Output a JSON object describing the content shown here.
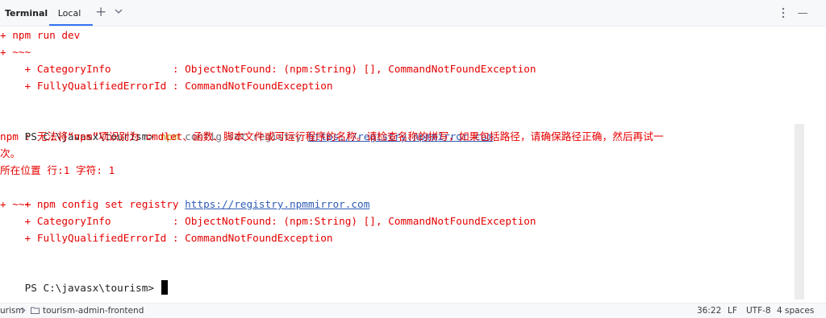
{
  "tabbar": {
    "title": "Terminal",
    "tabs": [
      {
        "label": "Local",
        "active": true
      }
    ],
    "icons": [
      "plus-icon",
      "chevron-down-icon",
      "kebab-menu-icon",
      "minimize-icon"
    ]
  },
  "terminal": {
    "lines": [
      {
        "kind": "error",
        "text": "+ npm run dev"
      },
      {
        "kind": "error",
        "text": "+ ~~~"
      },
      {
        "kind": "error",
        "text": "    + CategoryInfo          : ObjectNotFound: (npm:String) [], CommandNotFoundException"
      },
      {
        "kind": "error",
        "text": "    + FullyQualifiedErrorId : CommandNotFoundException"
      },
      {
        "kind": "prompt",
        "prompt": "PS C:\\javasx\\tourism> ",
        "command": "npm",
        "args": " config set registry ",
        "url": "https://registry.npmmirror.com"
      },
      {
        "kind": "error",
        "text": "npm : 无法将“npm”项识别为 cmdlet、函数、脚本文件或可运行程序的名称。请检查名称的拼写，如果包括路径，请确保路径正确，然后再试一"
      },
      {
        "kind": "error",
        "text": "次。"
      },
      {
        "kind": "error",
        "text": "所在位置 行:1 字符: 1"
      },
      {
        "kind": "error_link",
        "text": "+ npm config set registry ",
        "url": "https://registry.npmmirror.com"
      },
      {
        "kind": "error",
        "text": "+ ~~~"
      },
      {
        "kind": "error",
        "text": "    + CategoryInfo          : ObjectNotFound: (npm:String) [], CommandNotFoundException"
      },
      {
        "kind": "error",
        "text": "    + FullyQualifiedErrorId : CommandNotFoundException"
      },
      {
        "kind": "cursor_prompt",
        "prompt": "PS C:\\javasx\\tourism> "
      }
    ]
  },
  "statusbar": {
    "breadcrumb": [
      "urism",
      "tourism-admin-frontend"
    ],
    "position": "36:22",
    "line_ending": "LF",
    "encoding": "UTF-8",
    "indent": "4 spaces"
  },
  "colors": {
    "error": "#e50000",
    "command": "#c79b16",
    "link": "#2d5bb5",
    "accent": "#3574f0"
  }
}
